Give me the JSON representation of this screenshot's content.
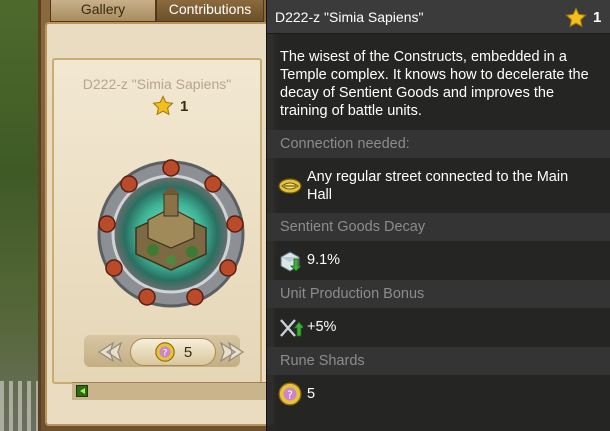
{
  "tabs": {
    "gallery": "Gallery",
    "contributions": "Contributions"
  },
  "card": {
    "title": "D222-z \"Simia Sapiens\"",
    "stars": "1",
    "shard_count": "5"
  },
  "tooltip": {
    "title": "D222-z \"Simia Sapiens\"",
    "stars": "1",
    "description": "The wisest of the Constructs, embedded in a Temple complex. It knows how to decelerate the decay of Sentient Goods and improves the training of battle units.",
    "connection_header": "Connection needed:",
    "connection_text": "Any regular street connected to the Main Hall",
    "decay_header": "Sentient Goods Decay",
    "decay_value": "9.1%",
    "production_header": "Unit Production Bonus",
    "production_value": "+5%",
    "shards_header": "Rune Shards",
    "shards_value": "5"
  },
  "colors": {
    "tooltip_bg": "#242424",
    "header_text": "#8c8c8c",
    "star": "#f2c01c",
    "scroll_handle": "#2f6a12"
  },
  "icons": [
    "star-icon",
    "street-icon",
    "goods-decay-icon",
    "unit-production-icon",
    "rune-shard-icon",
    "arrow-left-icon",
    "arrow-right-icon"
  ]
}
